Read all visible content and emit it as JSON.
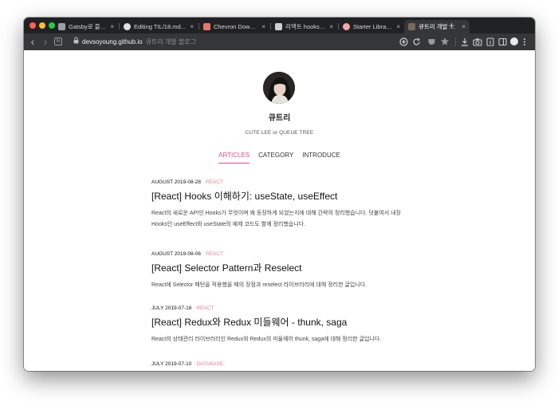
{
  "browser": {
    "tabs": [
      {
        "label": "Gatsby로 블로그 만...",
        "favicon_color": "#9aa0a6",
        "close": "×"
      },
      {
        "label": "Editing TIL/18.md...",
        "favicon_color": "#e0e0e0",
        "close": "×"
      },
      {
        "label": "Chevron Down Ic...",
        "favicon_color": "#e8756c",
        "close": "×"
      },
      {
        "label": "리액트 hooks, use...",
        "favicon_color": "#cfcfcf",
        "close": "×"
      },
      {
        "label": "Starter Library |...",
        "favicon_color": "#f3a6a6",
        "close": "×"
      },
      {
        "label": "큐트리 개발 블로그",
        "favicon_color": "#7a6a5a",
        "close": "×",
        "active": true
      }
    ],
    "new_tab": "+",
    "toolbar": {
      "back": "‹",
      "forward": "›",
      "site_info": "N",
      "lock": "🔒",
      "url": "devsoyoung.github.io",
      "page_title": "큐트리 개발 블로그"
    }
  },
  "blog": {
    "name": "큐트리",
    "subtitle": "CUTE LEE or QUEUE TREE",
    "nav": [
      {
        "label": "ARTICLES",
        "active": true
      },
      {
        "label": "CATEGORY",
        "active": false
      },
      {
        "label": "INTRODUCE",
        "active": false
      }
    ],
    "accent_color": "#e0507a",
    "articles": [
      {
        "date": "AUGUST 2019-08-28",
        "category": "REACT",
        "title": "[React] Hooks 이해하기: useState, useEffect",
        "description": "React의 새로운 API인 Hooks가 무엇이며 왜 등장하게 되었는지에 대해 간략히 정리했습니다. 덧붙여서 내장 Hooks인 useEffect와 useState의 예제 코드도 함께 정리했습니다."
      },
      {
        "date": "AUGUST 2019-08-06",
        "category": "REACT",
        "title": "[React] Selector Pattern과 Reselect",
        "description": "React에 Selector 패턴을 적용했을 때의 장점과 reselect 라이브러리에 대해 정리한 글입니다."
      },
      {
        "date": "JULY 2019-07-18",
        "category": "REACT",
        "title": "[React] Redux와 Redux 미들웨어 - thunk, saga",
        "description": "React의 상태관리 라이브러리인 Redux와 Redux의 미들웨어 thunk, saga에 대해 정리한 글입니다."
      },
      {
        "date": "JULY 2019-07-10",
        "category": "DATABASE",
        "title": "",
        "description": ""
      }
    ]
  }
}
